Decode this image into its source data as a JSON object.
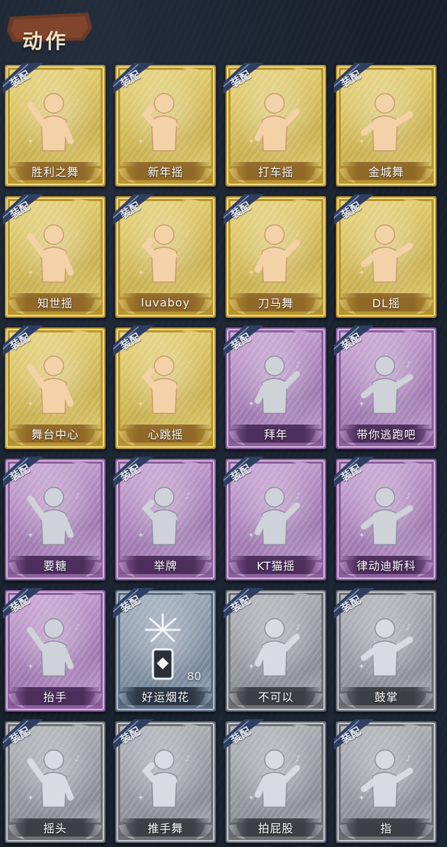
{
  "header": {
    "title": "动作"
  },
  "badge_label": "装配",
  "cards": [
    {
      "label": "胜利之舞",
      "tier": "gold"
    },
    {
      "label": "新年摇",
      "tier": "gold"
    },
    {
      "label": "打车摇",
      "tier": "gold"
    },
    {
      "label": "金城舞",
      "tier": "gold"
    },
    {
      "label": "知世摇",
      "tier": "gold"
    },
    {
      "label": "luvaboy",
      "tier": "gold"
    },
    {
      "label": "刀马舞",
      "tier": "gold"
    },
    {
      "label": "DL摇",
      "tier": "gold"
    },
    {
      "label": "舞台中心",
      "tier": "gold"
    },
    {
      "label": "心跳摇",
      "tier": "gold"
    },
    {
      "label": "拜年",
      "tier": "purple"
    },
    {
      "label": "带你逃跑吧",
      "tier": "purple"
    },
    {
      "label": "要糖",
      "tier": "purple"
    },
    {
      "label": "举牌",
      "tier": "purple"
    },
    {
      "label": "KT猫摇",
      "tier": "purple"
    },
    {
      "label": "律动迪斯科",
      "tier": "purple"
    },
    {
      "label": "抬手",
      "tier": "purple"
    },
    {
      "label": "好运烟花",
      "tier": "blue",
      "count": "80"
    },
    {
      "label": "不可以",
      "tier": "grey"
    },
    {
      "label": "鼓掌",
      "tier": "grey"
    },
    {
      "label": "摇头",
      "tier": "grey"
    },
    {
      "label": "推手舞",
      "tier": "grey"
    },
    {
      "label": "拍屁股",
      "tier": "grey"
    },
    {
      "label": "指",
      "tier": "grey"
    }
  ],
  "colors": {
    "background": "#17202c",
    "gold": "#d9c46a",
    "purple": "#b690c4",
    "blue": "#8e9cad",
    "grey": "#9fa3a8",
    "badge": "#2f3f62"
  }
}
